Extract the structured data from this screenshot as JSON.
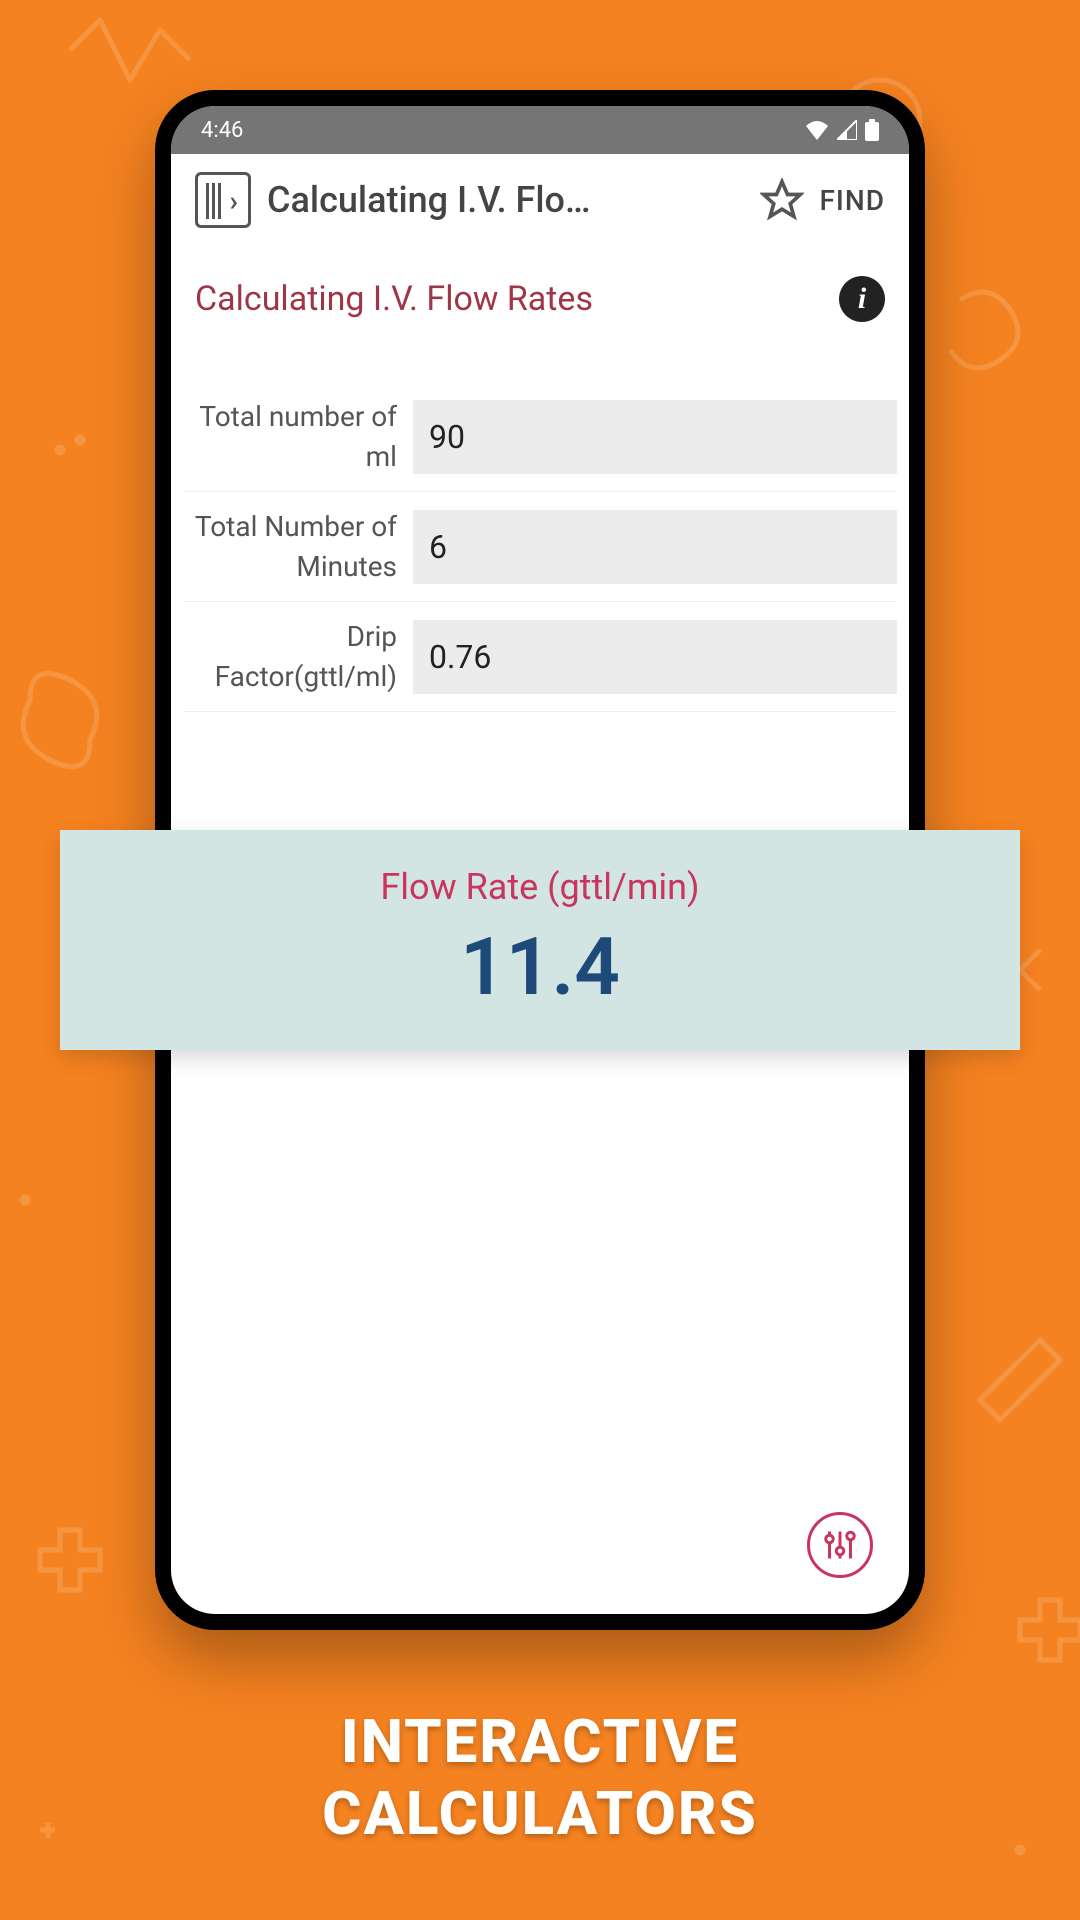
{
  "status": {
    "time": "4:46"
  },
  "appbar": {
    "title": "Calculating I.V. Flo…",
    "find": "FIND"
  },
  "page": {
    "title": "Calculating I.V. Flow Rates"
  },
  "fields": [
    {
      "label": "Total number of ml",
      "value": "90"
    },
    {
      "label": "Total Number of Minutes",
      "value": "6"
    },
    {
      "label": "Drip Factor(gttl/ml)",
      "value": "0.76"
    }
  ],
  "result": {
    "label": "Flow Rate (gttl/min)",
    "value": "11.4"
  },
  "caption": {
    "line1": "INTERACTIVE",
    "line2": "CALCULATORS"
  }
}
